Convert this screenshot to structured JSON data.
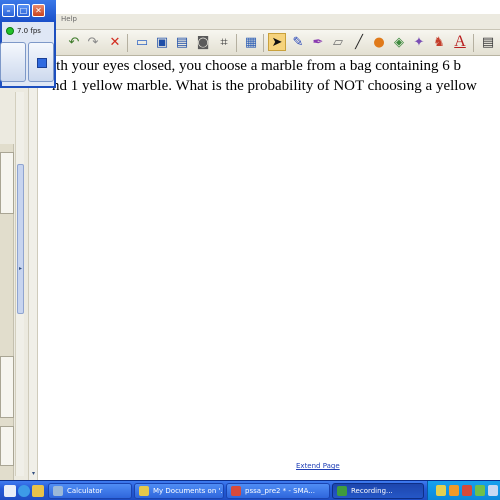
{
  "recorder": {
    "fps_label": "7.0 fps",
    "status_color": "#22c22b"
  },
  "menubar": {
    "help_label": "Help"
  },
  "toolbar": {
    "tools": [
      "undo-icon",
      "redo-icon",
      "delete-icon",
      "screen-shade-icon",
      "display-icon",
      "dual-display-icon",
      "capture-icon",
      "screen-capture-icon",
      "table-icon",
      "select-icon",
      "pen-icon",
      "creative-pen-icon",
      "eraser-icon",
      "line-icon",
      "shapes-icon",
      "fill-icon",
      "magic-pen-icon",
      "text-icon",
      "properties-icon",
      "more-icon"
    ],
    "selected_tool": "select-icon"
  },
  "page": {
    "question_line1": "ith your eyes closed, you choose a marble from a bag containing 6 b",
    "question_line2": "nd 1 yellow marble. What is the probability of NOT choosing a yellow",
    "extend_link": "Extend Page"
  },
  "taskbar": {
    "tasks": [
      {
        "label": "Calculator",
        "icon": "calculator-icon",
        "color": "#9bb8d8"
      },
      {
        "label": "My Documents on '...",
        "icon": "folder-icon",
        "color": "#e6c84a"
      },
      {
        "label": "pssa_pre2 * - SMA...",
        "icon": "smart-notebook-icon",
        "color": "#d84a3a"
      },
      {
        "label": "Recording...",
        "icon": "recorder-icon",
        "color": "#3f9b3f"
      }
    ],
    "active_index": 3,
    "accent": "#245ad6"
  }
}
